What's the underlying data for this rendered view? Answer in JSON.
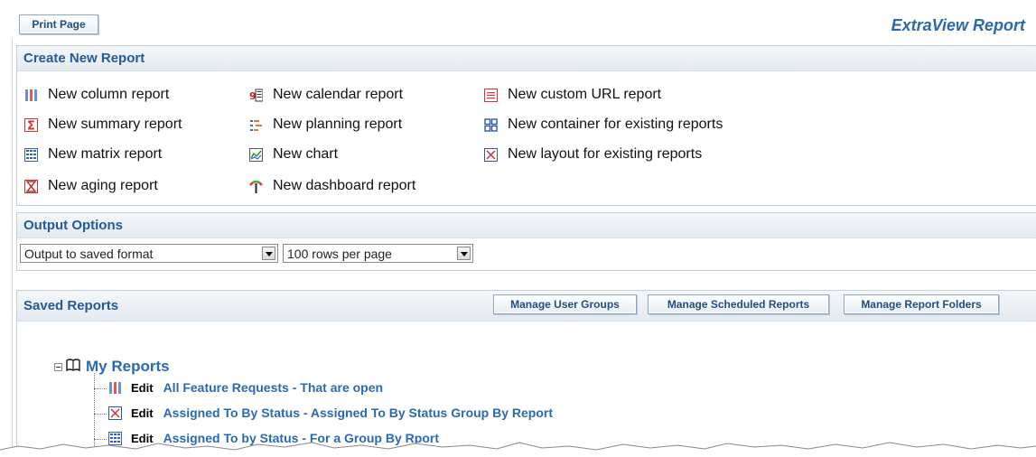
{
  "header": {
    "print_label": "Print Page",
    "brand": "ExtraView Report"
  },
  "create": {
    "title": "Create New Report",
    "col1": [
      {
        "label": "New column report",
        "icon": "column-report-icon"
      },
      {
        "label": "New summary report",
        "icon": "sigma-icon"
      },
      {
        "label": "New matrix report",
        "icon": "grid-icon"
      },
      {
        "label": "New aging report",
        "icon": "hourglass-icon"
      }
    ],
    "col2": [
      {
        "label": "New calendar report",
        "icon": "calendar-icon"
      },
      {
        "label": "New planning report",
        "icon": "planning-icon"
      },
      {
        "label": "New chart",
        "icon": "line-chart-icon"
      },
      {
        "label": "New dashboard report",
        "icon": "gauge-icon"
      }
    ],
    "col3": [
      {
        "label": "New custom URL report",
        "icon": "url-report-icon"
      },
      {
        "label": "New container for existing reports",
        "icon": "container-icon"
      },
      {
        "label": "New layout for existing reports",
        "icon": "layout-icon"
      }
    ]
  },
  "output": {
    "title": "Output Options",
    "format_value": "Output to saved format",
    "rows_value": "100 rows per page"
  },
  "saved": {
    "title": "Saved Reports",
    "manage_groups": "Manage User Groups",
    "manage_scheduled": "Manage Scheduled Reports",
    "manage_folders": "Manage Report Folders",
    "folder": "My Reports",
    "edit_label": "Edit",
    "reports": [
      {
        "title": "All Feature Requests - That are open",
        "icon": "column-report-icon"
      },
      {
        "title": "Assigned To By Status - Assigned To By Status Group By Report",
        "icon": "layout-icon"
      },
      {
        "title": "Assigned To by Status - For a Group By Rport",
        "icon": "grid-icon"
      }
    ]
  },
  "colors": {
    "accent": "#1f5c99",
    "link": "#2a6ab0",
    "brand": "#2b6aa8"
  }
}
